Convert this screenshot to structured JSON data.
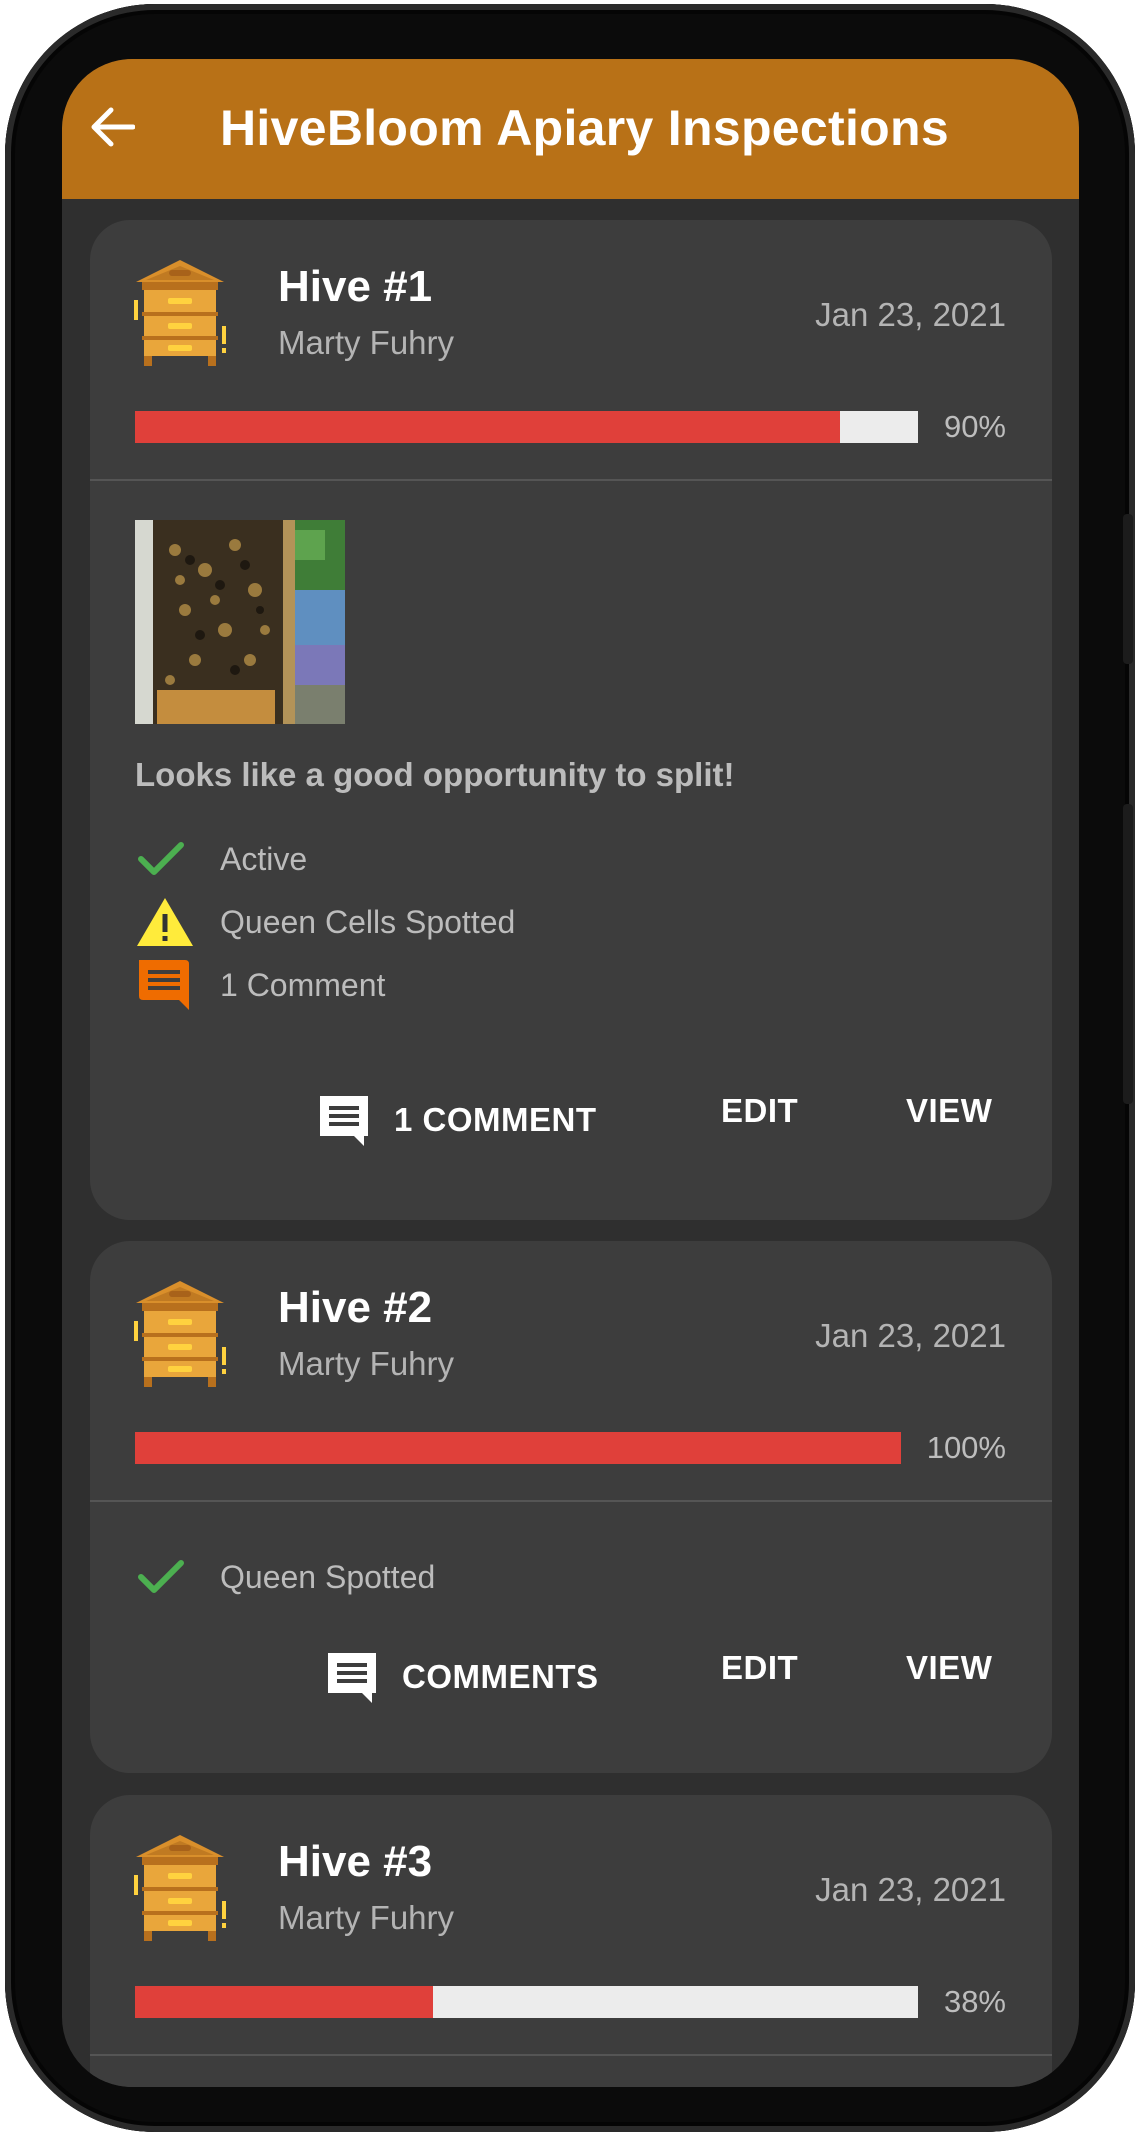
{
  "app": {
    "title": "HiveBloom Apiary Inspections",
    "accent_color": "#b87117",
    "background": "#2f2f2f",
    "card_color": "#3d3d3d",
    "progress_color": "#e0403a"
  },
  "cards": [
    {
      "name": "Hive #1",
      "owner": "Marty Fuhry",
      "date": "Jan 23, 2021",
      "progress_percent": 90,
      "progress_label": "90%",
      "has_photo": true,
      "note": "Looks like a good opportunity to split!",
      "statuses": [
        {
          "icon": "check-icon",
          "label": "Active"
        },
        {
          "icon": "warning-icon",
          "label": "Queen Cells Spotted"
        },
        {
          "icon": "comment-icon",
          "label": "1 Comment"
        }
      ],
      "actions": {
        "comment": "1 COMMENT",
        "edit": "EDIT",
        "view": "VIEW"
      }
    },
    {
      "name": "Hive #2",
      "owner": "Marty Fuhry",
      "date": "Jan 23, 2021",
      "progress_percent": 100,
      "progress_label": "100%",
      "statuses": [
        {
          "icon": "check-icon",
          "label": "Queen Spotted"
        }
      ],
      "actions": {
        "comment": "COMMENTS",
        "edit": "EDIT",
        "view": "VIEW"
      }
    },
    {
      "name": "Hive #3",
      "owner": "Marty Fuhry",
      "date": "Jan 23, 2021",
      "progress_percent": 38,
      "progress_label": "38%"
    }
  ]
}
